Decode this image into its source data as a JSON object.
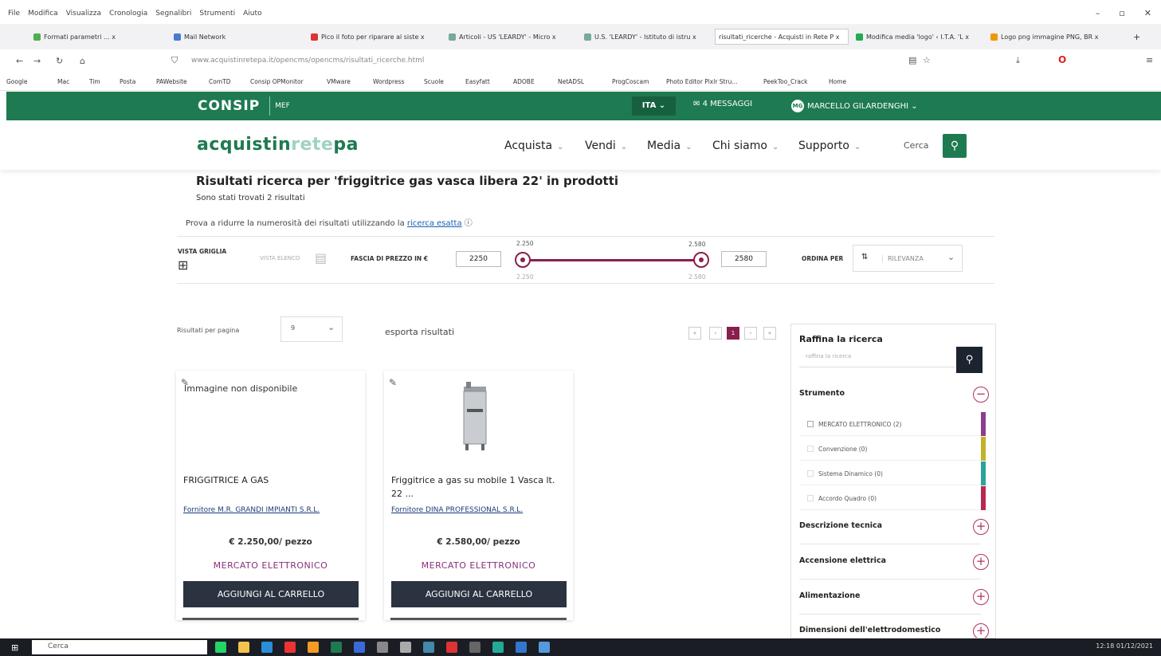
{
  "browser": {
    "menu": [
      "File",
      "Modifica",
      "Visualizza",
      "Cronologia",
      "Segnalibri",
      "Strumenti",
      "Aiuto"
    ],
    "tabs": [
      {
        "label": "Formati parametri ... x"
      },
      {
        "label": "Mail Network"
      },
      {
        "label": "Pico il foto per riparare al siste x"
      },
      {
        "label": "Articoli - US 'LEARDY' - Micro x"
      },
      {
        "label": "U.S. 'LEARDY' - Istituto di istru x"
      },
      {
        "label": "risultati_ricerche - Acquisti in Rete P x"
      },
      {
        "label": "Modifica media 'logo' ‹ I.T.A. 'L x"
      },
      {
        "label": "Logo png immagine PNG, BR x"
      }
    ],
    "url": "www.acquistinretepa.it/opencms/opencms/risultati_ricerche.html",
    "bookmarks": [
      "Google",
      "Mac",
      "Tim",
      "Posta",
      "PAWebsite",
      "ComTD",
      "Consip OPMonitor",
      "VMware",
      "Wordpress",
      "Scuole",
      "Easyfatt",
      "ADOBE",
      "NetADSL",
      "ProgCoscam",
      "Photo Editor Pixlr Stru...",
      "PeekToo_Crack",
      "Home"
    ]
  },
  "topbar": {
    "logo": "CONSIP",
    "mef": "MEF",
    "lang": "ITA",
    "messages": "4 MESSAGGI",
    "user_initials": "MG",
    "user": "MARCELLO GILARDENGHI"
  },
  "nav": {
    "brand_a": "acquistin",
    "brand_b": "rete",
    "brand_c": "pa",
    "items": [
      "Acquista",
      "Vendi",
      "Media",
      "Chi siamo",
      "Supporto"
    ],
    "search_label": "Cerca"
  },
  "results": {
    "heading": "Risultati ricerca per 'friggitrice gas vasca libera 22' in prodotti",
    "count_text": "Sono stati trovati 2 risultati",
    "hint_text": "Prova a ridurre la numerosità dei risultati utilizzando la",
    "hint_link": "ricerca esatta",
    "view_grid": "VISTA GRIGLIA",
    "view_list": "VISTA ELENCO",
    "price_label": "FASCIA DI PREZZO IN €",
    "price_min": "2250",
    "price_max": "2580",
    "tick_min_top": "2.250",
    "tick_max_top": "2.580",
    "tick_min_bottom": "2.250",
    "tick_max_bottom": "2.580",
    "sort_label": "ORDINA PER",
    "sort_value": "RILEVANZA",
    "per_page_label": "Risultati per pagina",
    "per_page_value": "9",
    "export": "esporta risultati",
    "current_page": "1"
  },
  "products": [
    {
      "no_image": "Immagine non disponibile",
      "title": "FRIGGITRICE A GAS",
      "supplier": "Fornitore M.R. GRANDI IMPIANTI S.R.L.",
      "price": "€ 2.250,00/ pezzo",
      "market": "MERCATO ELETTRONICO",
      "cart": "AGGIUNGI AL CARRELLO"
    },
    {
      "title": "Friggitrice a gas su mobile 1 Vasca lt. 22 ...",
      "supplier": "Fornitore DINA PROFESSIONAL S.R.L.",
      "price": "€ 2.580,00/ pezzo",
      "market": "MERCATO ELETTRONICO",
      "cart": "AGGIUNGI AL CARRELLO"
    }
  ],
  "refine": {
    "title": "Raffina la ricerca",
    "placeholder": "raffina la ricerca",
    "strumento": "Strumento",
    "options": [
      {
        "label": "MERCATO ELETTRONICO (2)",
        "color": "#8a3f8a"
      },
      {
        "label": "Convenzione (0)",
        "color": "#c2b22a"
      },
      {
        "label": "Sistema Dinamico (0)",
        "color": "#2aa39a"
      },
      {
        "label": "Accordo Quadro (0)",
        "color": "#b8294f"
      }
    ],
    "facets": [
      "Descrizione tecnica",
      "Accensione elettrica",
      "Alimentazione",
      "Dimensioni dell'elettrodomestico"
    ]
  },
  "taskbar": {
    "search": "Cerca",
    "time": "12:18",
    "date": "01/12/2021"
  },
  "colors": {
    "consip_green": "#1e7a50",
    "accent": "#8a1f4e",
    "cart_button": "#2b3340"
  }
}
